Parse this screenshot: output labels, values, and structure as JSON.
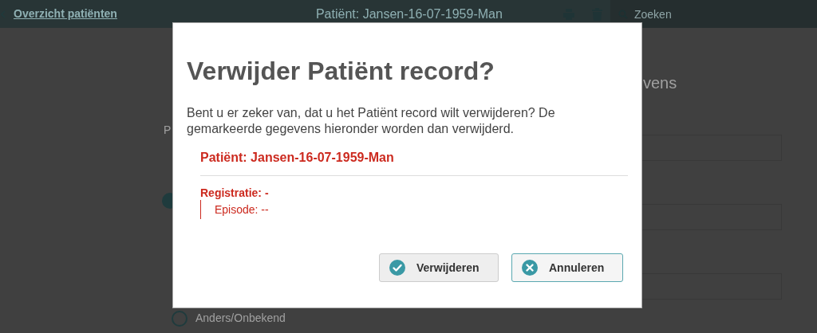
{
  "header": {
    "back_link": "Overzicht patiënten",
    "title": "Patiënt: Jansen-16-07-1959-Man",
    "search": {
      "placeholder": "Zoeken"
    }
  },
  "background": {
    "section_heading": "vens",
    "field_label": "P",
    "radios": [
      {
        "selected": true
      },
      {
        "label": "Anders/Onbekend",
        "selected": false
      }
    ]
  },
  "dialog": {
    "title": "Verwijder Patiënt record?",
    "message": "Bent u er zeker van, dat u het Patiënt record wilt verwijderen? De gemarkeerde gegevens hieronder worden dan verwijderd.",
    "patient": "Patiënt: Jansen-16-07-1959-Man",
    "registration": "Registratie: -",
    "episode": "Episode: --",
    "buttons": [
      {
        "kind": "confirm",
        "label": "Verwijderen"
      },
      {
        "kind": "cancel",
        "label": "Annuleren"
      }
    ]
  }
}
